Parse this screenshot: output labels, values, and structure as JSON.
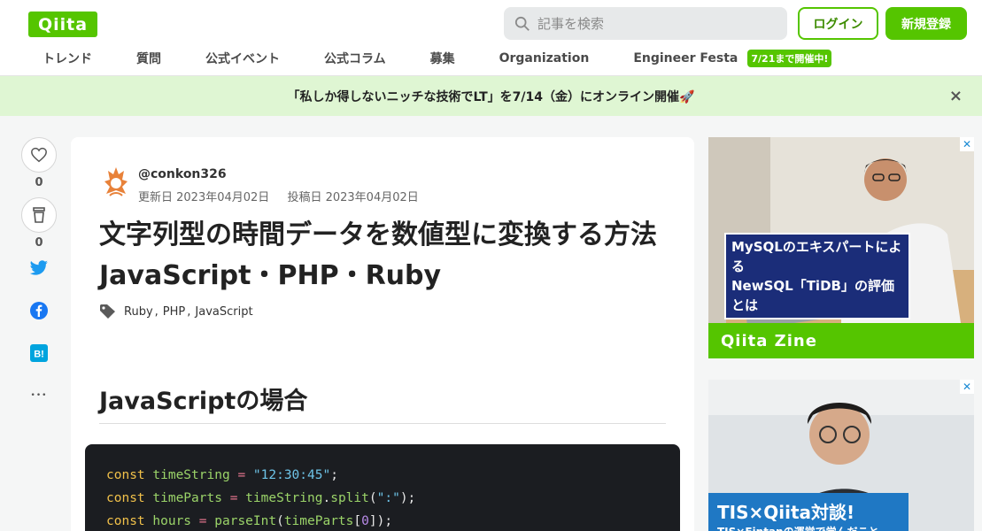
{
  "header": {
    "logo_text": "Qiita",
    "search_placeholder": "記事を検索",
    "login_label": "ログイン",
    "signup_label": "新規登録"
  },
  "nav": {
    "items": [
      "トレンド",
      "質問",
      "公式イベント",
      "公式コラム",
      "募集",
      "Organization",
      "Engineer Festa"
    ],
    "badge": "7/21まで開催中!"
  },
  "banner": {
    "text": "「私しか得しないニッチな技術でLT」を7/14（金）にオンライン開催🚀",
    "close": "×"
  },
  "social": {
    "likes": "0",
    "stocks": "0",
    "more": "•••"
  },
  "article": {
    "author": "@conkon326",
    "updated": "更新日 2023年04月02日",
    "posted": "投稿日 2023年04月02日",
    "title": "文字列型の時間データを数値型に変換する方法 JavaScript・PHP・Ruby",
    "tags": [
      "Ruby",
      "PHP",
      "JavaScript"
    ],
    "section_heading": "JavaScriptの場合"
  },
  "code": {
    "line1": {
      "kw": "const",
      "var": "timeString",
      "op": "=",
      "str": "\"12:30:45\"",
      "end": ";"
    },
    "line2": {
      "kw": "const",
      "var": "timeParts",
      "op": "=",
      "obj": "timeString",
      "dot": ".",
      "fn": "split",
      "open": "(",
      "str": "\":\"",
      "close": ");"
    },
    "line3": {
      "kw": "const",
      "var": "hours",
      "op": "=",
      "fn": "parseInt",
      "open": "(",
      "arg": "timeParts",
      "lb": "[",
      "num": "0",
      "rb": "]",
      "close": ");"
    }
  },
  "ads": {
    "ad1_caption_line1": "MySQLのエキスパートによる",
    "ad1_caption_line2": "NewSQL「TiDB」の評価とは",
    "ad1_brand": "Qiita Zine",
    "ad2_title": "TIS×Qiita対談!",
    "ad2_sub": "TIS×Fintanの運営で学んだこと",
    "close": "✕"
  },
  "colors": {
    "brand": "#55c500",
    "banner_bg": "#dff6d3",
    "code_bg": "#1b1d21"
  }
}
